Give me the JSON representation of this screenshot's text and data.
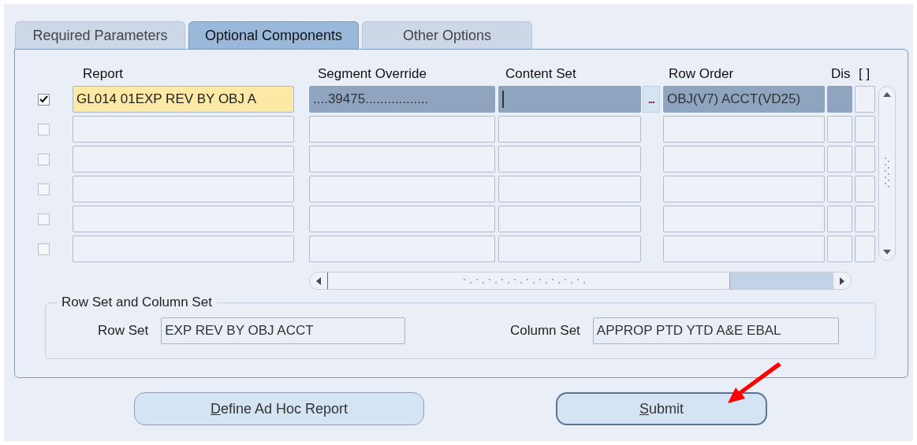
{
  "tabs": [
    {
      "label": "Required Parameters",
      "selected": false
    },
    {
      "label": "Optional Components",
      "selected": true
    },
    {
      "label": "Other Options",
      "selected": false
    }
  ],
  "table": {
    "columns": [
      "Report",
      "Segment Override",
      "Content Set",
      "Row Order",
      "Dis",
      "[ ]"
    ],
    "rows": [
      {
        "checked": true,
        "selected": true,
        "cursor": true,
        "report": "GL014 01EXP REV BY OBJ A",
        "segment_override": "....39475.................",
        "list_button": "...",
        "row_order": "OBJ(V7) ACCT(VD25)"
      },
      {
        "checked": false,
        "selected": false,
        "cursor": false
      },
      {
        "checked": false,
        "selected": false,
        "cursor": false
      },
      {
        "checked": false,
        "selected": false,
        "cursor": false
      },
      {
        "checked": false,
        "selected": false,
        "cursor": false
      },
      {
        "checked": false,
        "selected": false,
        "cursor": false
      }
    ]
  },
  "row_set_and_column_set": {
    "title": "Row Set and Column Set",
    "row_set_label": "Row Set",
    "row_set": "EXP REV BY OBJ ACCT",
    "column_set_label": "Column Set",
    "column_set": "APPROP PTD YTD A&E EBAL"
  },
  "buttons": [
    {
      "label": "Define Ad Hoc Report",
      "focused": false
    },
    {
      "label": "Submit",
      "focused": true
    }
  ]
}
